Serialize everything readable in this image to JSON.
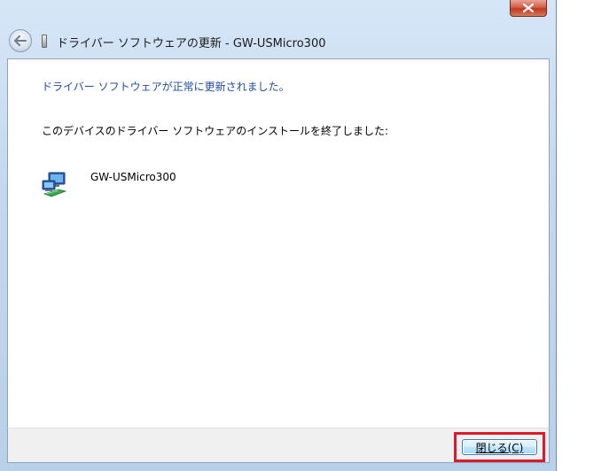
{
  "window": {
    "title": "ドライバー ソフトウェアの更新 - GW-USMicro300"
  },
  "content": {
    "heading": "ドライバー ソフトウェアが正常に更新されました。",
    "message": "このデバイスのドライバー ソフトウェアのインストールを終了しました:",
    "device_name": "GW-USMicro300"
  },
  "footer": {
    "close_label": "閉じる(C)"
  },
  "colors": {
    "heading_blue": "#1f4ea1",
    "highlight_red": "#e0182a"
  },
  "icons": [
    "close-icon",
    "back-arrow-icon",
    "device-manager-icon",
    "network-adapter-icon"
  ]
}
